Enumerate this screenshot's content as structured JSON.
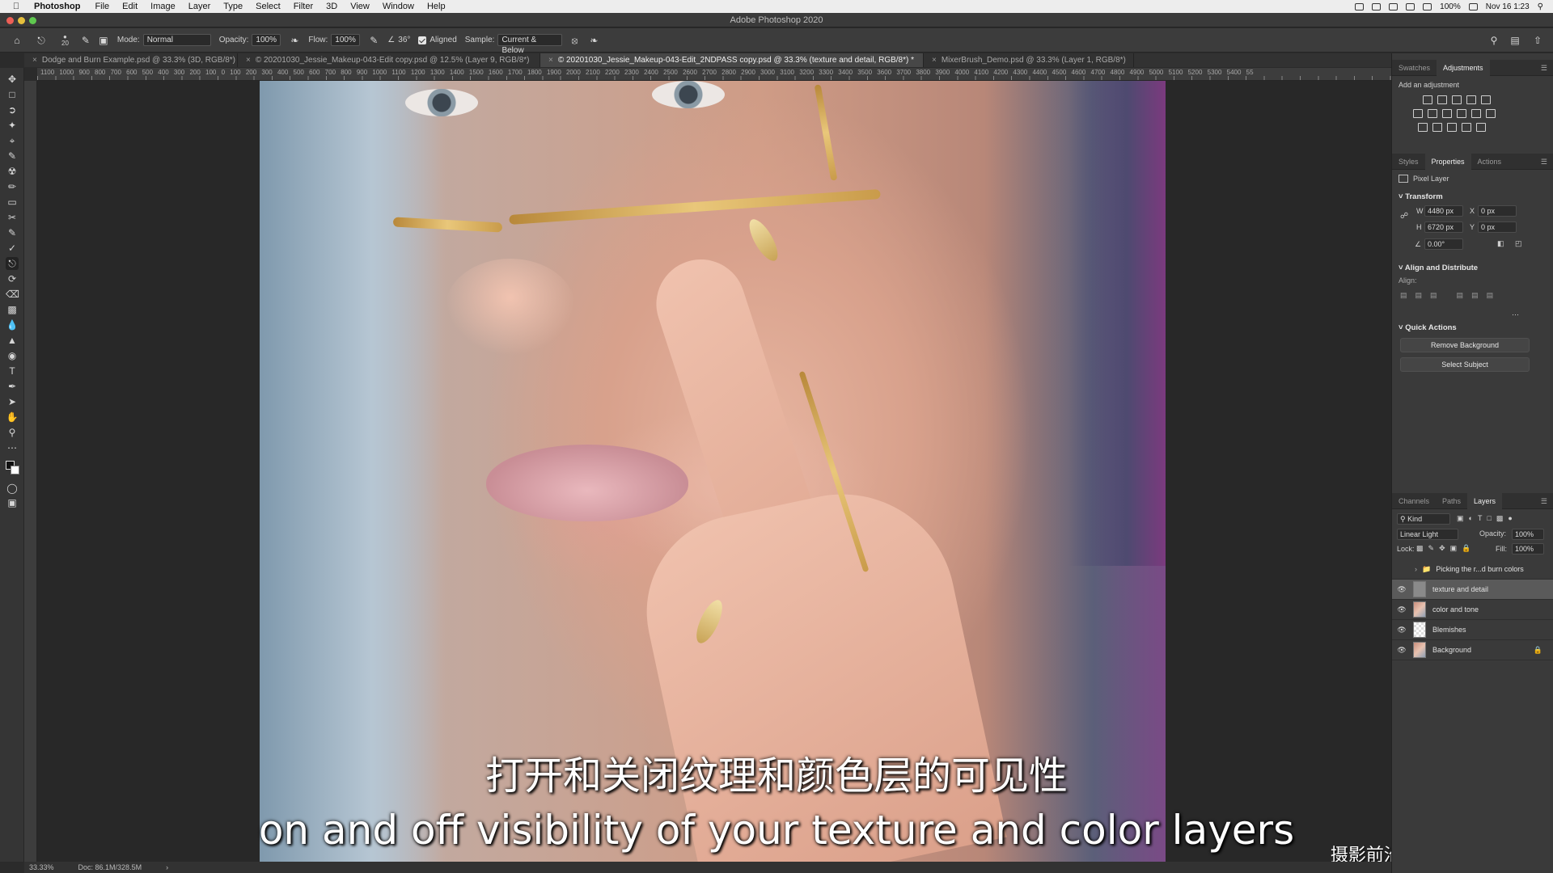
{
  "menubar": {
    "app": "Photoshop",
    "items": [
      "File",
      "Edit",
      "Image",
      "Layer",
      "Type",
      "Select",
      "Filter",
      "3D",
      "View",
      "Window",
      "Help"
    ],
    "battery": "100%",
    "datetime": "Nov 16 1:23"
  },
  "window": {
    "title": "Adobe Photoshop 2020"
  },
  "options": {
    "brush_size": "20",
    "mode_label": "Mode:",
    "mode_value": "Normal",
    "opacity_label": "Opacity:",
    "opacity_value": "100%",
    "flow_label": "Flow:",
    "flow_value": "100%",
    "angle_value": "36°",
    "aligned_label": "Aligned",
    "sample_label": "Sample:",
    "sample_value": "Current & Below"
  },
  "tabs": [
    "Dodge and Burn Example.psd @ 33.3% (3D, RGB/8*)",
    "© 20201030_Jessie_Makeup-043-Edit copy.psd @ 12.5% (Layer 9, RGB/8*)",
    "© 20201030_Jessie_Makeup-043-Edit_2NDPASS copy.psd @ 33.3% (texture and detail, RGB/8*) *",
    "MixerBrush_Demo.psd @ 33.3% (Layer 1, RGB/8*)"
  ],
  "ruler": {
    "labels": "1100 1000 900 800 700 600 500 400 300 200 100 0 100 200 300 400 500 600 700 800 900 1000 1100 1200 1300 1400 1500 1600 1700 1800 1900 2000 2100 2200 2300 2400 2500 2600 2700 2800 2900 3000 3100 3200 3300 3400 3500 3600 3700 3800 3900 4000 4100 4200 4300 4400 4500 4600 4700 4800 4900 5000 5100 5200 5300 5400 55"
  },
  "subtitles": {
    "chinese": "打开和关闭纹理和颜色层的可见性",
    "english": "on and off visibility of your texture and color layers"
  },
  "watermark": "摄影前沿 sheyingzyz.com",
  "statusbar": {
    "zoom": "33.33%",
    "doc": "Doc: 86.1M/328.5M"
  },
  "panels": {
    "top_tabs": [
      "Swatches",
      "Adjustments"
    ],
    "add_adjustment": "Add an adjustment",
    "mid_tabs": [
      "Styles",
      "Properties",
      "Actions"
    ],
    "pixel_layer": "Pixel Layer",
    "transform": "Transform",
    "w_label": "W",
    "w_value": "4480 px",
    "x_label": "X",
    "x_value": "0 px",
    "h_label": "H",
    "h_value": "6720 px",
    "y_label": "Y",
    "y_value": "0 px",
    "angle_value": "0.00°",
    "align_distribute": "Align and Distribute",
    "align_label": "Align:",
    "quick_actions": "Quick Actions",
    "remove_background": "Remove Background",
    "select_subject": "Select Subject",
    "layer_tabs": [
      "Channels",
      "Paths",
      "Layers"
    ],
    "kind": "Kind",
    "blend_mode": "Linear Light",
    "opacity_label": "Opacity:",
    "opacity_value": "100%",
    "lock_label": "Lock:",
    "fill_label": "Fill:",
    "fill_value": "100%",
    "layers": [
      {
        "name": "Picking the r...d burn colors",
        "type": "group"
      },
      {
        "name": "texture and detail",
        "type": "gray",
        "selected": true
      },
      {
        "name": "color and tone",
        "type": "face"
      },
      {
        "name": "Blemishes",
        "type": "check"
      },
      {
        "name": "Background",
        "type": "face",
        "locked": true
      }
    ]
  },
  "colors": {
    "accent": "#5a5a5a",
    "panel": "#3a3a3a",
    "canvas": "#282828"
  }
}
